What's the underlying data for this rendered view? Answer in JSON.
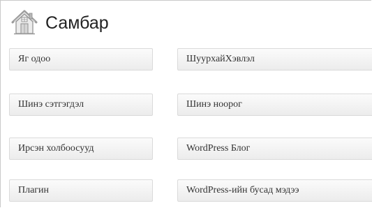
{
  "widget": {
    "title": "Самбар",
    "icon": "home-icon"
  },
  "links": {
    "left": [
      {
        "label": "Яг одоо",
        "name": "link-right-now"
      },
      {
        "label": "Шинэ сэтгэгдэл",
        "name": "link-recent-comments"
      },
      {
        "label": "Ирсэн холбоосууд",
        "name": "link-incoming-links"
      },
      {
        "label": "Плагин",
        "name": "link-plugins"
      }
    ],
    "right": [
      {
        "label": "ШуурхайХэвлэл",
        "name": "link-quickpress"
      },
      {
        "label": "Шинэ ноорог",
        "name": "link-recent-drafts"
      },
      {
        "label": "WordPress Блог",
        "name": "link-wordpress-blog"
      },
      {
        "label": "WordPress-ийн бусад мэдээ",
        "name": "link-other-wordpress-news"
      }
    ]
  },
  "colors": {
    "border": "#dadada",
    "button_top": "#fbfbfb",
    "button_bottom": "#ececec",
    "text": "#333333"
  }
}
